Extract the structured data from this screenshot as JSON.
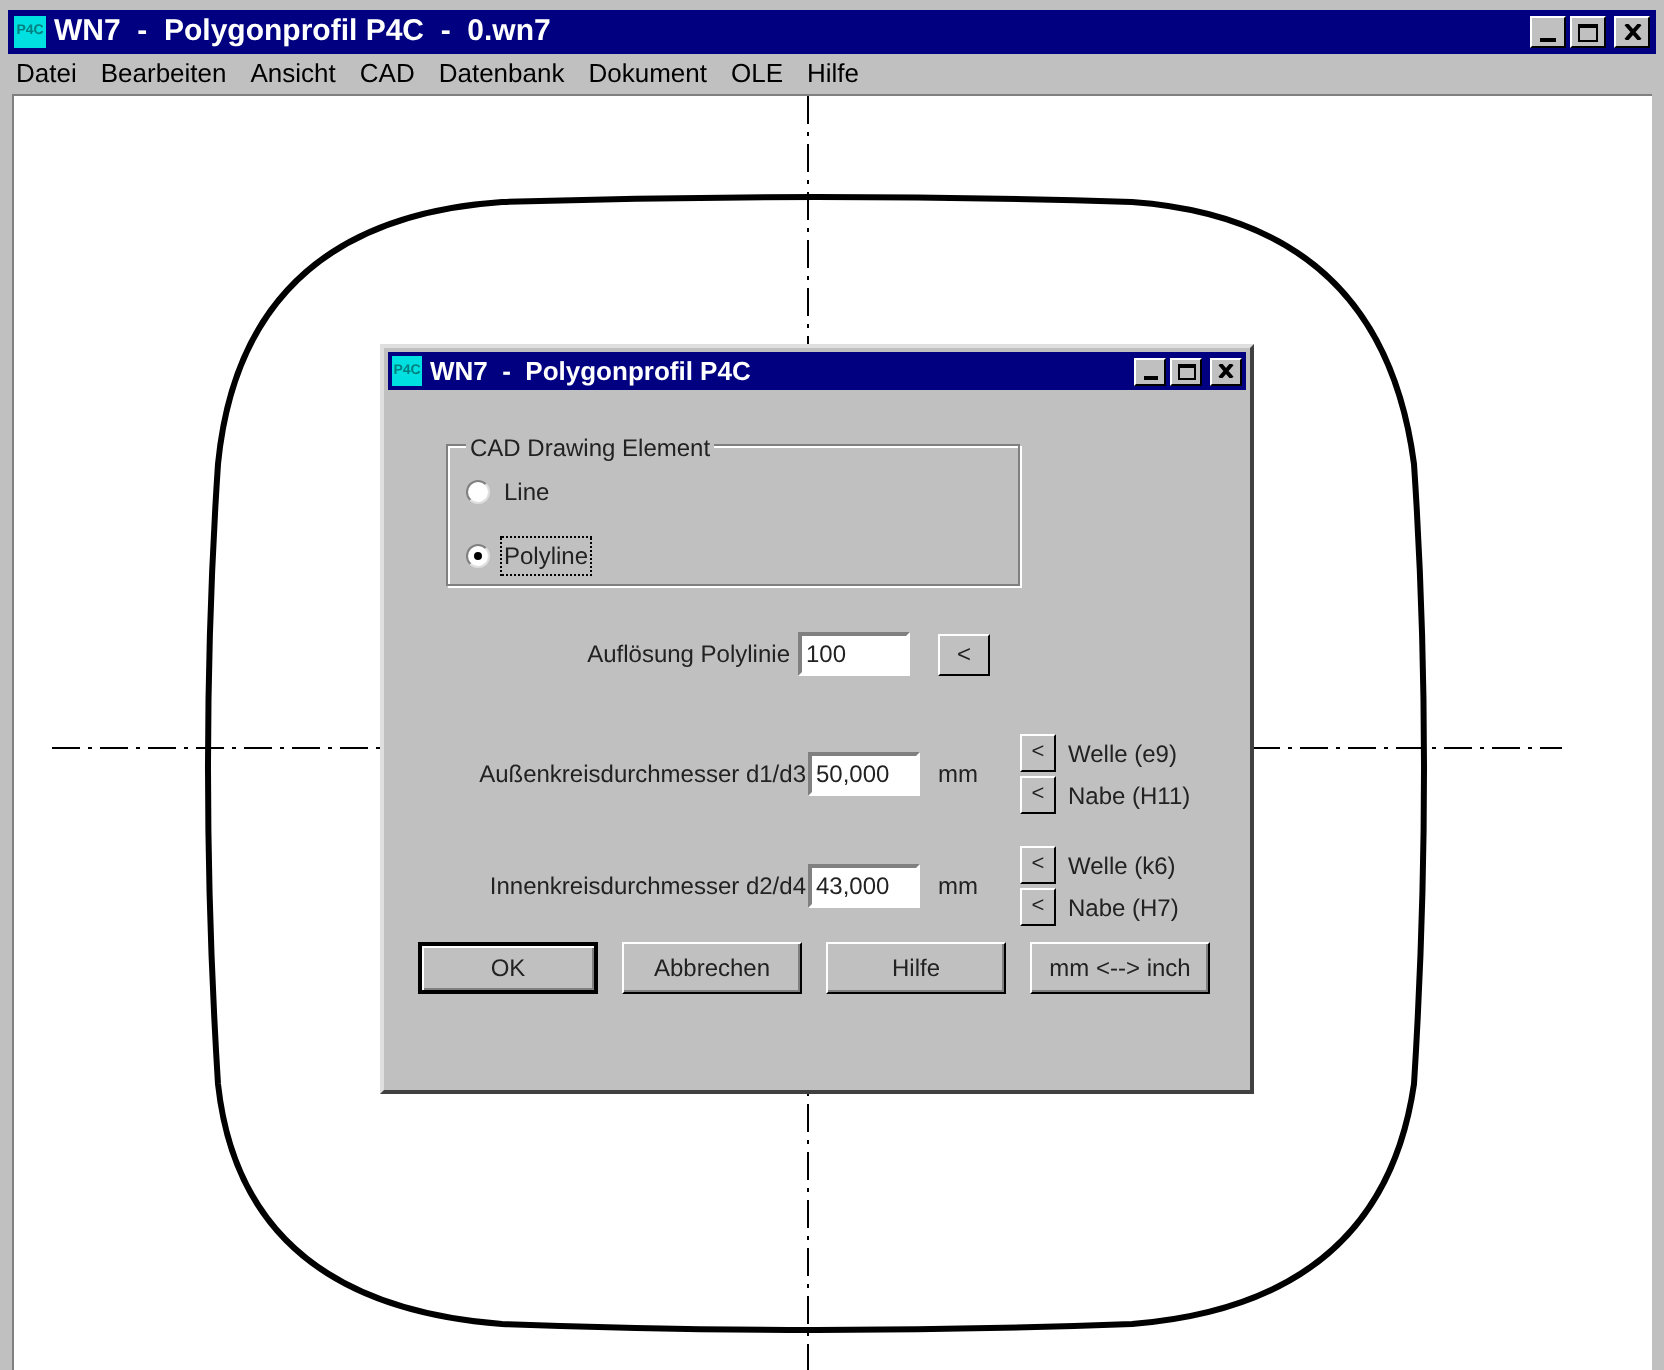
{
  "window": {
    "icon_text": "P4C",
    "title": "WN7  -  Polygonprofil P4C  -  0.wn7"
  },
  "menu": [
    {
      "label": "Datei"
    },
    {
      "label": "Bearbeiten"
    },
    {
      "label": "Ansicht"
    },
    {
      "label": "CAD"
    },
    {
      "label": "Datenbank"
    },
    {
      "label": "Dokument"
    },
    {
      "label": "OLE"
    },
    {
      "label": "Hilfe"
    }
  ],
  "dialog": {
    "icon_text": "P4C",
    "title": "WN7  -  Polygonprofil P4C",
    "group": {
      "label": "CAD Drawing Element",
      "options": [
        {
          "label": "Line",
          "selected": false,
          "focused": false
        },
        {
          "label": "Polyline",
          "selected": true,
          "focused": true
        }
      ]
    },
    "resolution": {
      "label": "Auflösung Polylinie",
      "value": "100",
      "button": "<"
    },
    "diameters": [
      {
        "label": "Außenkreisdurchmesser d1/d3",
        "value": "50,000",
        "unit": "mm",
        "fits": [
          {
            "button": "<",
            "label": "Welle (e9)"
          },
          {
            "button": "<",
            "label": "Nabe (H11)"
          }
        ]
      },
      {
        "label": "Innenkreisdurchmesser d2/d4",
        "value": "43,000",
        "unit": "mm",
        "fits": [
          {
            "button": "<",
            "label": "Welle (k6)"
          },
          {
            "button": "<",
            "label": "Nabe (H7)"
          }
        ]
      }
    ],
    "buttons": [
      {
        "label": "OK",
        "default": true
      },
      {
        "label": "Abbrechen",
        "default": false
      },
      {
        "label": "Hilfe",
        "default": false
      },
      {
        "label": "mm <--> inch",
        "default": false
      }
    ]
  }
}
